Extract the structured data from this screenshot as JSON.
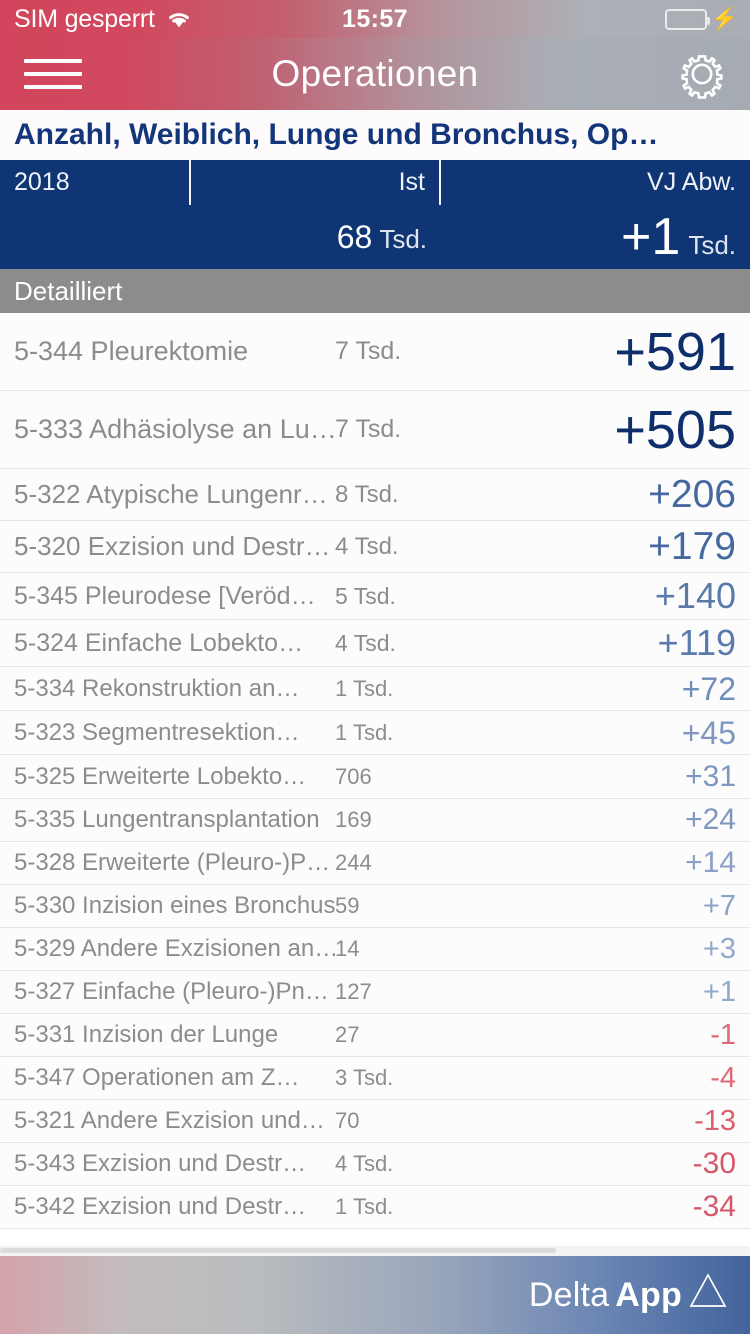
{
  "status_bar": {
    "carrier": "SIM gesperrt",
    "wifi_icon": "wifi-icon",
    "time": "15:57",
    "battery_icon": "battery-icon",
    "charging_icon": "lightning-bolt-icon",
    "battery_color": "#4cd964"
  },
  "nav_bar": {
    "menu_icon": "hamburger-menu-icon",
    "title": "Operationen",
    "settings_icon": "gear-icon"
  },
  "report": {
    "title": "Anzahl,  Weiblich, Lunge und Bronchus, Op…",
    "title_color": "#13357a"
  },
  "columns": {
    "year": "2018",
    "actual": "Ist",
    "deviation": "VJ Abw."
  },
  "summary": {
    "actual_value": "68",
    "actual_unit": "Tsd.",
    "deviation_value": "+1",
    "deviation_unit": "Tsd.",
    "background": "#0f3575"
  },
  "section": {
    "label": "Detailliert",
    "background": "#8c8c8c"
  },
  "table": {
    "rows": [
      {
        "label": "5-344 Pleurektomie",
        "value": "7 Tsd.",
        "delta": "+591",
        "sign": "positive"
      },
      {
        "label": "5-333 Adhäsiolyse an Lu…",
        "value": "7 Tsd.",
        "delta": "+505",
        "sign": "positive"
      },
      {
        "label": "5-322 Atypische Lungenr…",
        "value": "8 Tsd.",
        "delta": "+206",
        "sign": "positive"
      },
      {
        "label": "5-320 Exzision und Destr…",
        "value": "4 Tsd.",
        "delta": "+179",
        "sign": "positive"
      },
      {
        "label": "5-345 Pleurodese [Veröd…",
        "value": "5 Tsd.",
        "delta": "+140",
        "sign": "positive"
      },
      {
        "label": "5-324 Einfache Lobekto…",
        "value": "4 Tsd.",
        "delta": "+119",
        "sign": "positive"
      },
      {
        "label": "5-334 Rekonstruktion an…",
        "value": "1 Tsd.",
        "delta": "+72",
        "sign": "positive"
      },
      {
        "label": "5-323 Segmentresektion…",
        "value": "1 Tsd.",
        "delta": "+45",
        "sign": "positive"
      },
      {
        "label": "5-325 Erweiterte Lobekto…",
        "value": "706",
        "delta": "+31",
        "sign": "positive"
      },
      {
        "label": "5-335 Lungentransplantation",
        "value": "169",
        "delta": "+24",
        "sign": "positive"
      },
      {
        "label": "5-328 Erweiterte (Pleuro-)P…",
        "value": "244",
        "delta": "+14",
        "sign": "positive"
      },
      {
        "label": "5-330 Inzision eines Bronchus",
        "value": "59",
        "delta": "+7",
        "sign": "positive"
      },
      {
        "label": "5-329 Andere Exzisionen an…",
        "value": "14",
        "delta": "+3",
        "sign": "positive"
      },
      {
        "label": "5-327 Einfache (Pleuro-)Pn…",
        "value": "127",
        "delta": "+1",
        "sign": "positive"
      },
      {
        "label": "5-331 Inzision der Lunge",
        "value": "27",
        "delta": "-1",
        "sign": "negative"
      },
      {
        "label": "5-347 Operationen am Z…",
        "value": "3 Tsd.",
        "delta": "-4",
        "sign": "negative"
      },
      {
        "label": "5-321 Andere Exzision und…",
        "value": "70",
        "delta": "-13",
        "sign": "negative"
      },
      {
        "label": "5-343 Exzision und Destr…",
        "value": "4 Tsd.",
        "delta": "-30",
        "sign": "negative"
      },
      {
        "label": "5-342 Exzision und Destr…",
        "value": "1 Tsd.",
        "delta": "-34",
        "sign": "negative"
      }
    ]
  },
  "footer": {
    "brand_prefix": "Delta",
    "brand_suffix": "App",
    "logo_icon": "triangle-logo-icon"
  }
}
